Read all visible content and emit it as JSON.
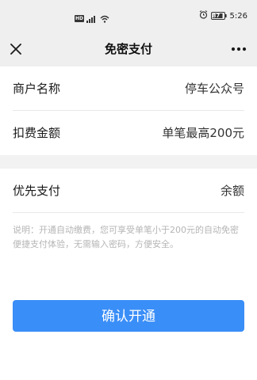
{
  "status_bar": {
    "network_badge": "HD",
    "signal": "⁴ᴳ",
    "battery": "87",
    "time": "5:26"
  },
  "nav": {
    "title": "免密支付",
    "close_icon": "close-icon",
    "more_icon": "more-icon"
  },
  "merchant_section": {
    "rows": [
      {
        "label": "商户名称",
        "value": "停车公众号"
      },
      {
        "label": "扣费金额",
        "value": "单笔最高200元"
      }
    ]
  },
  "payment_section": {
    "rows": [
      {
        "label": "优先支付",
        "value": "余额"
      }
    ],
    "note": "说明：开通自动缴费，您可享受单笔小于200元的自动免密便捷支付体验，无需输入密码，方便安全。"
  },
  "actions": {
    "confirm_label": "确认开通"
  },
  "colors": {
    "accent": "#3a8ef7",
    "background": "#f2f2f2",
    "card": "#ffffff"
  }
}
